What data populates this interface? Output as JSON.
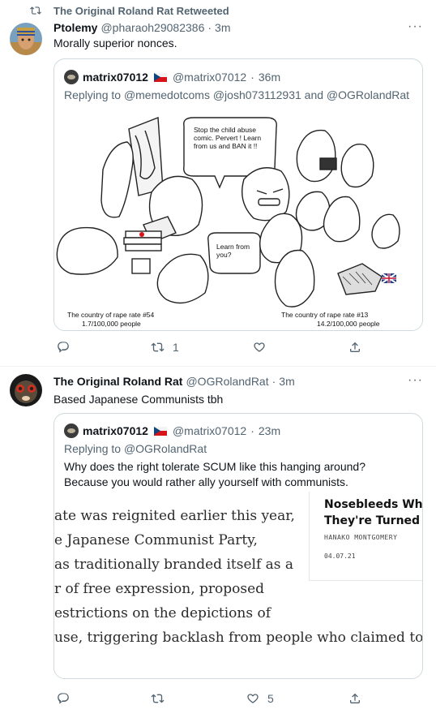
{
  "tweet1": {
    "retweet_label": "The Original Roland Rat Retweeted",
    "author_name": "Ptolemy",
    "author_handle": "@pharaoh29082386",
    "separator": "·",
    "time": "3m",
    "text": "Morally superior nonces.",
    "quote": {
      "name": "matrix07012",
      "handle": "@matrix07012",
      "separator": "·",
      "time": "36m",
      "replying_prefix": "Replying to",
      "replying_mentions": "@memedotcoms @josh073112931 and @OGRolandRat",
      "comic": {
        "bubble1": "Stop the child abuse comic. Pervert ! Learn from us and BAN it !!",
        "bubble2": "Learn from you?",
        "caption_left_1": "The country of rape rate #54",
        "caption_left_2": "1.7/100,000 people",
        "caption_right_1": "The country of rape rate #13",
        "caption_right_2": "14.2/100,000 people"
      }
    },
    "actions": {
      "reply_count": "",
      "retweet_count": "1",
      "like_count": ""
    }
  },
  "tweet2": {
    "author_name": "The Original Roland Rat",
    "author_handle": "@OGRolandRat",
    "separator": "·",
    "time": "3m",
    "text": "Based Japanese Communists tbh",
    "quote": {
      "name": "matrix07012",
      "handle": "@matrix07012",
      "separator": "·",
      "time": "23m",
      "replying_prefix": "Replying to",
      "replying_mentions": "@OGRolandRat",
      "text": "Why does the right tolerate SCUM like this hanging around? Because you would rather ally yourself with communists.",
      "article": {
        "lines": [
          "ate was reignited earlier this year,",
          "e Japanese Communist Party,",
          "as traditionally branded itself as a",
          "r of free expression, proposed",
          "estrictions on the depictions of",
          "use, triggering backlash from people who claimed to supp"
        ],
        "card_title_1": "Nosebleeds Whe",
        "card_title_2": "They're Turned C",
        "card_author": "HANAKO MONTGOMERY",
        "card_date": "04.07.21"
      }
    },
    "actions": {
      "reply_count": "",
      "retweet_count": "",
      "like_count": "5"
    }
  },
  "icons": {
    "retweet": "retweet-icon",
    "reply": "reply-icon",
    "like": "heart-icon",
    "share": "share-icon",
    "more": "more-icon"
  },
  "colors": {
    "secondary_text": "#536471",
    "border": "#cfd9de"
  }
}
